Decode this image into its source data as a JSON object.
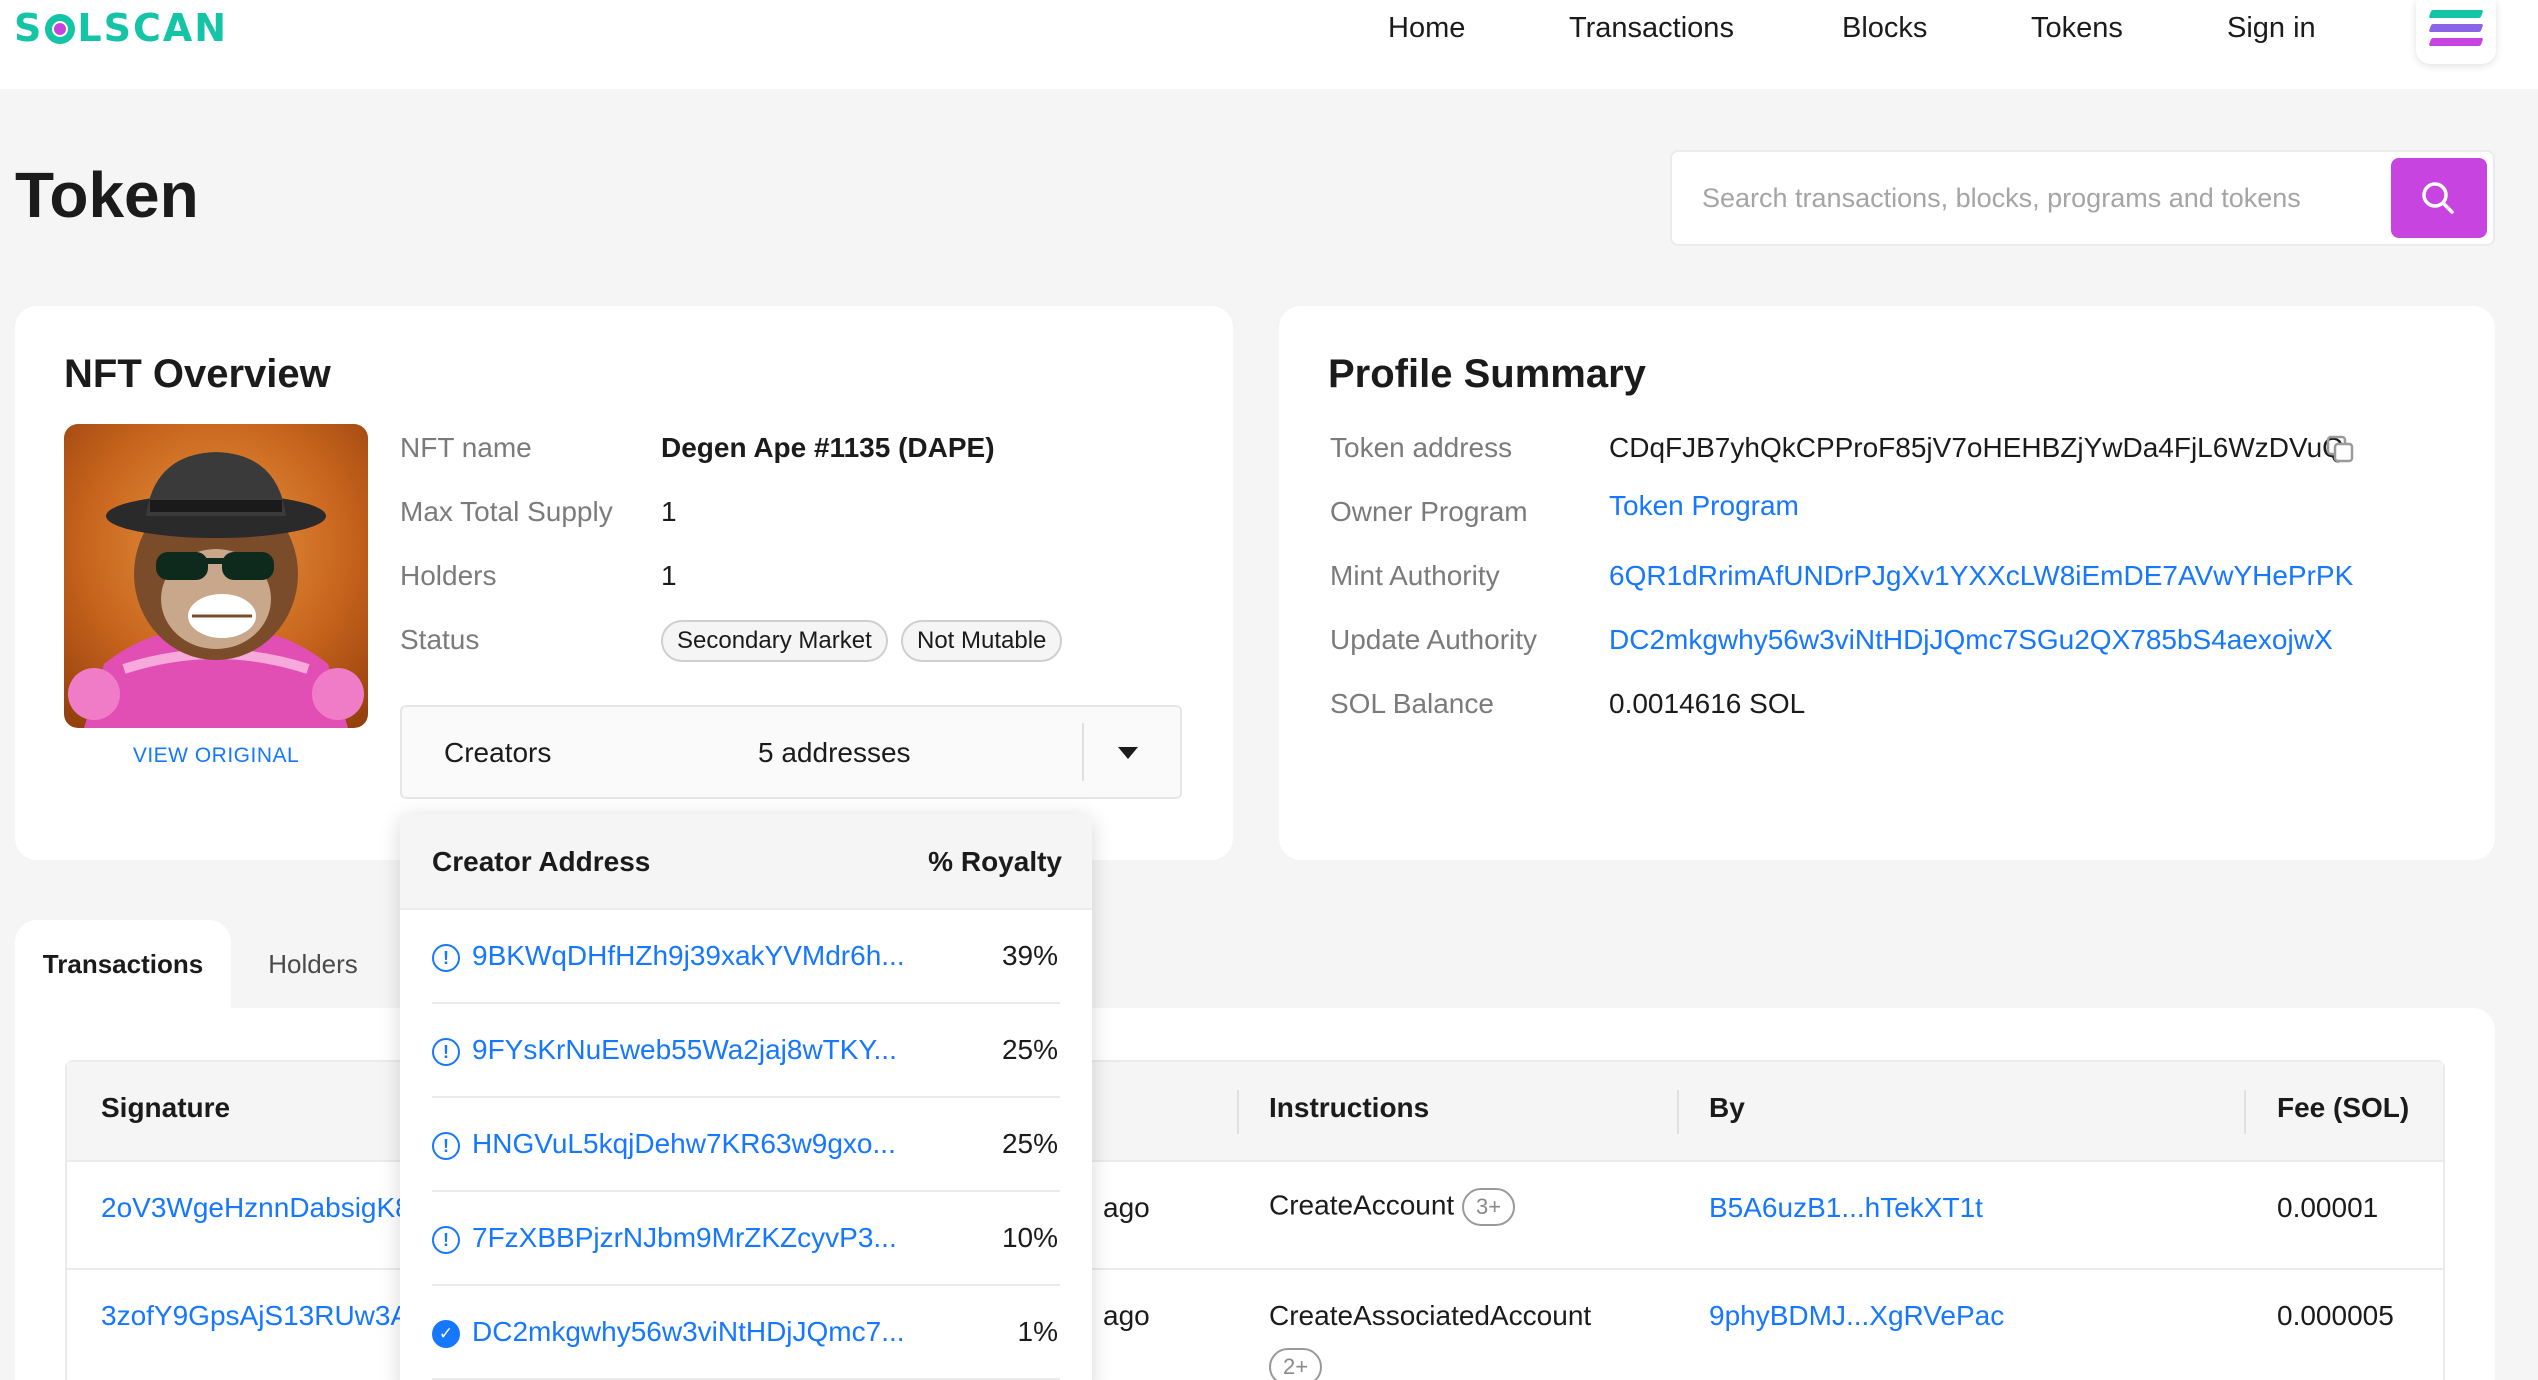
{
  "header": {
    "logo": "SOLSCAN",
    "nav": [
      "Home",
      "Transactions",
      "Blocks",
      "Tokens",
      "Sign in"
    ],
    "menu_icon": "solana-menu-icon"
  },
  "page": {
    "title": "Token",
    "search_placeholder": "Search transactions, blocks, programs and tokens",
    "search_icon": "search-icon"
  },
  "nft_overview": {
    "title": "NFT Overview",
    "view_original": "VIEW ORIGINAL",
    "fields": {
      "name_label": "NFT name",
      "name_value": "Degen Ape #1135 (DAPE)",
      "supply_label": "Max Total Supply",
      "supply_value": "1",
      "holders_label": "Holders",
      "holders_value": "1",
      "status_label": "Status",
      "status_badges": [
        "Secondary Market",
        "Not Mutable"
      ]
    },
    "creators": {
      "label": "Creators",
      "summary": "5 addresses"
    }
  },
  "profile_summary": {
    "title": "Profile Summary",
    "token_address_label": "Token address",
    "token_address": "CDqFJB7yhQkCPProF85jV7oHEHBZjYwDa4FjL6WzDVuQ",
    "owner_program_label": "Owner Program",
    "owner_program": "Token Program",
    "mint_authority_label": "Mint Authority",
    "mint_authority": "6QR1dRrimAfUNDrPJgXv1YXXcLW8iEmDE7AVwYHePrPK",
    "update_authority_label": "Update Authority",
    "update_authority": "DC2mkgwhy56w3viNtHDjJQmc7SGu2QX785bS4aexojwX",
    "sol_balance_label": "SOL Balance",
    "sol_balance": "0.0014616 SOL"
  },
  "tabs": [
    "Transactions",
    "Holders"
  ],
  "transactions_table": {
    "columns": [
      "Signature",
      "Instructions",
      "By",
      "Fee (SOL)"
    ],
    "rows": [
      {
        "signature": "2oV3WgeHznnDabsigK8",
        "time": "ago",
        "instruction": "CreateAccount",
        "extra": "3+",
        "by": "B5A6uzB1...hTekXT1t",
        "fee": "0.00001"
      },
      {
        "signature": "3zofY9GpsAjS13RUw3A",
        "time": "ago",
        "instruction": "CreateAssociatedAccount",
        "extra": "2+",
        "by": "9phyBDMJ...XgRVePac",
        "fee": "0.000005"
      }
    ]
  },
  "creators_dropdown": {
    "col_address": "Creator Address",
    "col_royalty": "% Royalty",
    "rows": [
      {
        "address": "9BKWqDHfHZh9j39xakYVMdr6h...",
        "royalty": "39%",
        "verified": false
      },
      {
        "address": "9FYsKrNuEweb55Wa2jaj8wTKY...",
        "royalty": "25%",
        "verified": false
      },
      {
        "address": "HNGVuL5kqjDehw7KR63w9gxo...",
        "royalty": "25%",
        "verified": false
      },
      {
        "address": "7FzXBBPjzrNJbm9MrZKZcyvP3...",
        "royalty": "10%",
        "verified": false
      },
      {
        "address": "DC2mkgwhy56w3viNtHDjJQmc7...",
        "royalty": "1%",
        "verified": true
      }
    ]
  },
  "colors": {
    "brand_green": "#13c4a6",
    "brand_purple": "#c744e0",
    "link_blue": "#1677ff"
  }
}
